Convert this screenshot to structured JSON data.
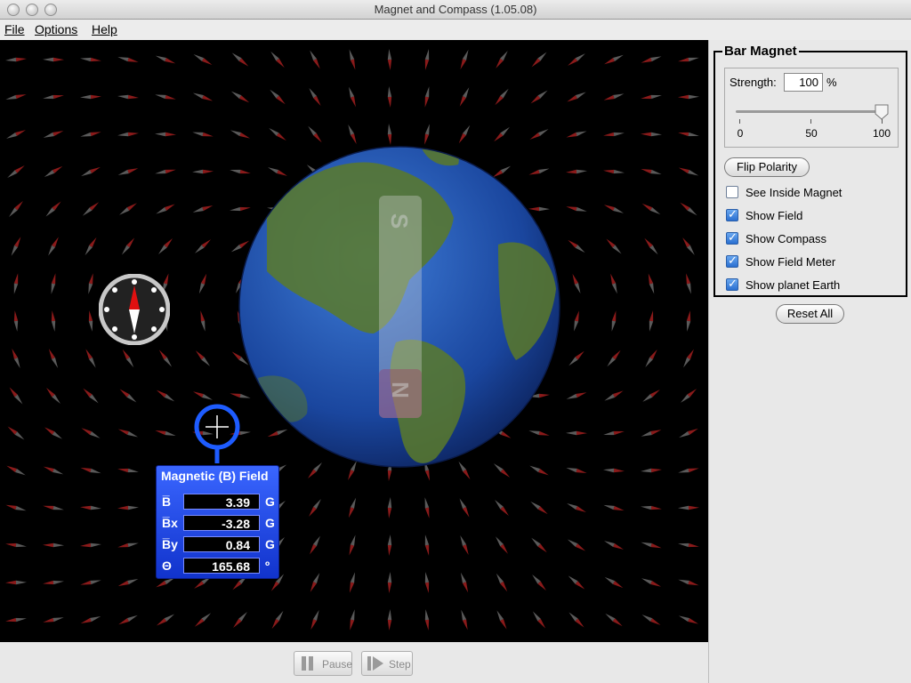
{
  "window": {
    "title": "Magnet and Compass (1.05.08)"
  },
  "menu": {
    "items": [
      "File",
      "Options",
      "Help"
    ]
  },
  "magnet": {
    "south_label": "S",
    "north_label": "N"
  },
  "field_meter": {
    "title": "Magnetic (B) Field",
    "rows": [
      {
        "label": "B̅",
        "value": "3.39",
        "unit": "G"
      },
      {
        "label": "B̅x",
        "value": "-3.28",
        "unit": "G"
      },
      {
        "label": "B̅y",
        "value": "0.84",
        "unit": "G"
      },
      {
        "label": "Θ",
        "value": "165.68",
        "unit": "º"
      }
    ]
  },
  "playback": {
    "pause_label": "Pause",
    "step_label": "Step"
  },
  "panel": {
    "group_title": "Bar Magnet",
    "strength_label": "Strength:",
    "strength_value": "100",
    "strength_unit": "%",
    "slider": {
      "value": 100,
      "min": 0,
      "max": 100,
      "ticks": [
        "0",
        "50",
        "100"
      ]
    },
    "flip_label": "Flip Polarity",
    "checkboxes": [
      {
        "label": "See Inside Magnet",
        "checked": false
      },
      {
        "label": "Show Field",
        "checked": true
      },
      {
        "label": "Show Compass",
        "checked": true
      },
      {
        "label": "Show Field Meter",
        "checked": true
      },
      {
        "label": "Show planet Earth",
        "checked": true
      }
    ],
    "reset_label": "Reset All"
  },
  "colors": {
    "canvas_bg": "#000000",
    "meter_bg": "#2a55ff",
    "needle_north": "#cc0000",
    "earth_ocean": "#1f4ea8",
    "earth_land": "#4d7a2c"
  }
}
